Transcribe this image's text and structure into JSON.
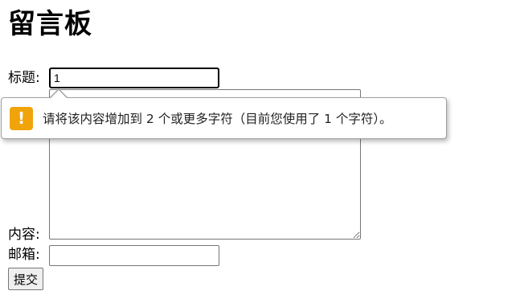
{
  "page": {
    "heading": "留言板"
  },
  "form": {
    "title_label": "标题:",
    "title_value": "1",
    "content_label": "内容:",
    "content_value": "",
    "email_label": "邮箱:",
    "email_value": "",
    "submit_label": "提交"
  },
  "validation_tooltip": {
    "icon": "warning-icon",
    "icon_glyph": "!",
    "icon_color": "#f0a30a",
    "message": "请将该内容增加到 2 个或更多字符（目前您使用了 1 个字符）。"
  }
}
